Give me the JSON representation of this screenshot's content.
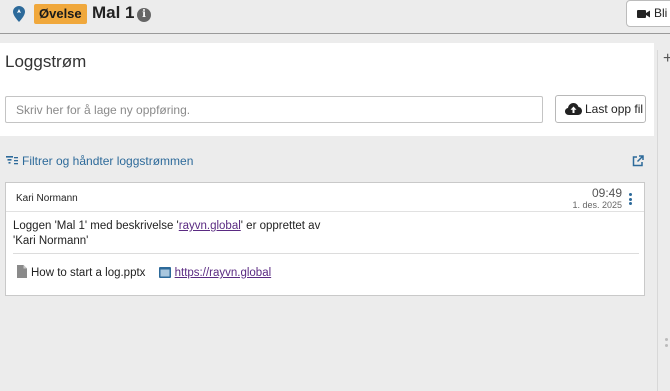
{
  "header": {
    "mode_badge": "Øvelse",
    "title": "Mal 1",
    "info_glyph": "i",
    "join_label": "Bli m",
    "icons": {
      "pin": "map-pin-icon",
      "info": "info-icon",
      "video": "video-camera-icon"
    }
  },
  "log_stream": {
    "title": "Loggstrøm",
    "entry_placeholder": "Skriv her for å lage ny oppføring.",
    "upload_label": "Last opp fil",
    "filter_label": "Filtrer og håndter loggstrømmen",
    "icons": {
      "upload": "cloud-upload-icon",
      "filter": "filter-icon",
      "external": "external-link-icon"
    }
  },
  "entries": [
    {
      "author": "Kari Normann",
      "time": "09:49",
      "date": "1. des. 2025",
      "text_before": "Loggen 'Mal 1' med beskrivelse '",
      "link_text": "rayvn.global",
      "text_after_line1": "' er opprettet av",
      "text_line2": "'Kari Normann'",
      "attachments": [
        {
          "name": "How to start a log.pptx",
          "icon": "file-icon"
        },
        {
          "name": "https://rayvn.global",
          "icon": "link-icon"
        }
      ]
    }
  ],
  "colors": {
    "badge": "#f0a83c",
    "link": "#5a2a82",
    "accent": "#2d6a9a",
    "background": "#ececec"
  }
}
